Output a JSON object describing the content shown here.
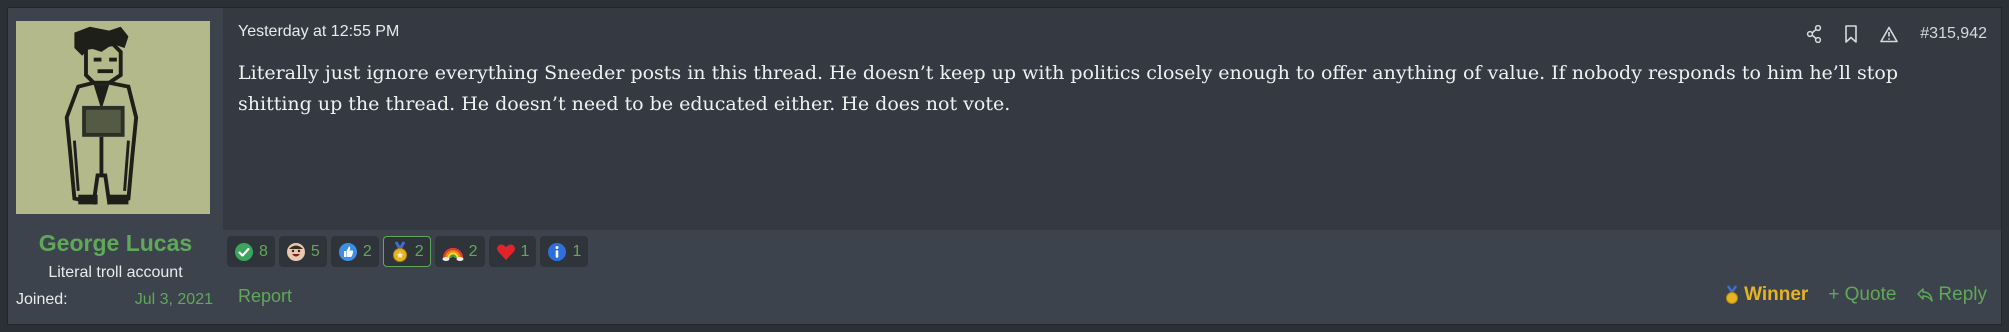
{
  "user": {
    "name": "George Lucas",
    "title": "Literal troll account",
    "joined_label": "Joined:",
    "joined_date": "Jul 3, 2021"
  },
  "post": {
    "timestamp": "Yesterday at 12:55 PM",
    "number": "#315,942",
    "body": "Literally just ignore everything Sneeder posts in this thread. He doesn’t keep up with politics closely enough to offer anything of value. If nobody responds to him he’ll stop shitting up the thread. He doesn’t need to be educated either. He does not vote."
  },
  "reactions": [
    {
      "icon": "checkmark-icon",
      "count": "8"
    },
    {
      "icon": "laughing-face-icon",
      "count": "5"
    },
    {
      "icon": "thumbs-up-icon",
      "count": "2"
    },
    {
      "icon": "medal-icon",
      "count": "2"
    },
    {
      "icon": "rainbow-icon",
      "count": "2"
    },
    {
      "icon": "heart-icon",
      "count": "1"
    },
    {
      "icon": "info-icon",
      "count": "1"
    }
  ],
  "footer": {
    "report": "Report",
    "winner": "Winner",
    "quote": "+ Quote",
    "reply": "Reply"
  },
  "colors": {
    "accent_green": "#5fa85a",
    "winner_gold": "#e6b422",
    "panel_dark": "#353a42",
    "panel_light": "#3d434c"
  }
}
